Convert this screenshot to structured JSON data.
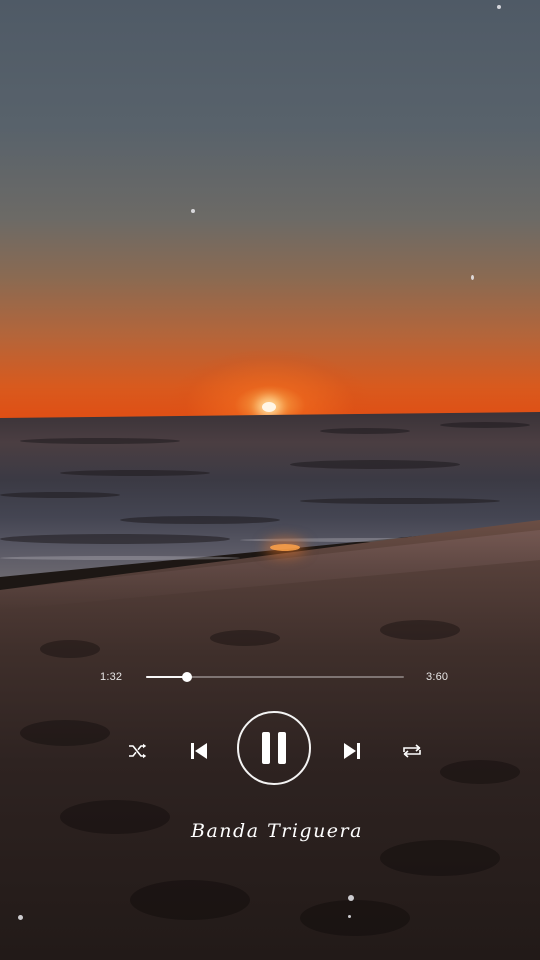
{
  "player": {
    "elapsed": "1:32",
    "total": "3:60",
    "progress_fraction": 0.16,
    "artist": "Banda Triguera",
    "state": "playing"
  },
  "controls": {
    "shuffle_icon": "shuffle-icon",
    "previous_icon": "skip-previous-icon",
    "play_pause_icon": "pause-icon",
    "next_icon": "skip-next-icon",
    "repeat_icon": "repeat-icon"
  },
  "colors": {
    "text": "#ffffff",
    "track": "rgba(255,255,255,0.35)",
    "sun": "#e04e14"
  }
}
